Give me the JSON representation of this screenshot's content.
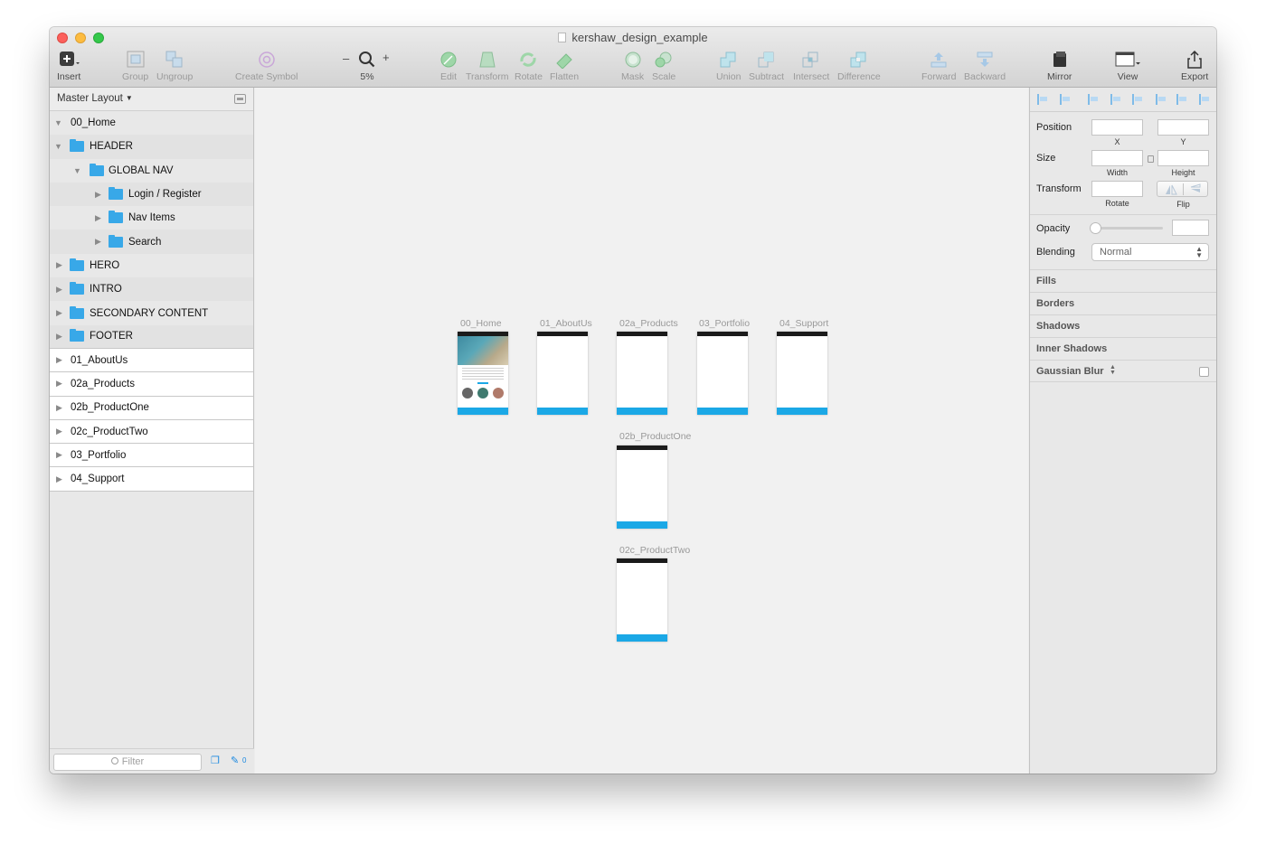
{
  "window": {
    "title": "kershaw_design_example"
  },
  "toolbar": {
    "insert": "Insert",
    "group": "Group",
    "ungroup": "Ungroup",
    "create_symbol": "Create Symbol",
    "zoom_minus": "–",
    "zoom_plus": "+",
    "zoom_level": "5%",
    "edit": "Edit",
    "transform": "Transform",
    "rotate": "Rotate",
    "flatten": "Flatten",
    "mask": "Mask",
    "scale": "Scale",
    "union": "Union",
    "subtract": "Subtract",
    "intersect": "Intersect",
    "difference": "Difference",
    "forward": "Forward",
    "backward": "Backward",
    "mirror": "Mirror",
    "view": "View",
    "export": "Export"
  },
  "sidebar": {
    "page_selector": "Master Layout",
    "layers": [
      {
        "name": "00_Home"
      },
      {
        "name": "HEADER"
      },
      {
        "name": "GLOBAL NAV"
      },
      {
        "name": "Login / Register"
      },
      {
        "name": "Nav Items"
      },
      {
        "name": "Search"
      },
      {
        "name": "HERO"
      },
      {
        "name": "INTRO"
      },
      {
        "name": "SECONDARY CONTENT"
      },
      {
        "name": "FOOTER"
      },
      {
        "name": "01_AboutUs"
      },
      {
        "name": "02a_Products"
      },
      {
        "name": "02b_ProductOne"
      },
      {
        "name": "02c_ProductTwo"
      },
      {
        "name": "03_Portfolio"
      },
      {
        "name": "04_Support"
      }
    ],
    "filter_placeholder": "Filter",
    "footer_count": "0"
  },
  "canvas": {
    "artboards": [
      {
        "name": "00_Home"
      },
      {
        "name": "01_AboutUs"
      },
      {
        "name": "02a_Products"
      },
      {
        "name": "03_Portfolio"
      },
      {
        "name": "04_Support"
      },
      {
        "name": "02b_ProductOne"
      },
      {
        "name": "02c_ProductTwo"
      }
    ]
  },
  "inspector": {
    "position": "Position",
    "x": "X",
    "y": "Y",
    "size": "Size",
    "width": "Width",
    "height": "Height",
    "transform": "Transform",
    "rotate": "Rotate",
    "flip": "Flip",
    "opacity": "Opacity",
    "blending": "Blending",
    "blending_value": "Normal",
    "fills": "Fills",
    "borders": "Borders",
    "shadows": "Shadows",
    "inner_shadows": "Inner Shadows",
    "gaussian_blur": "Gaussian Blur"
  },
  "colors": {
    "accent": "#1ba8e6",
    "folder": "#38a8e8"
  }
}
